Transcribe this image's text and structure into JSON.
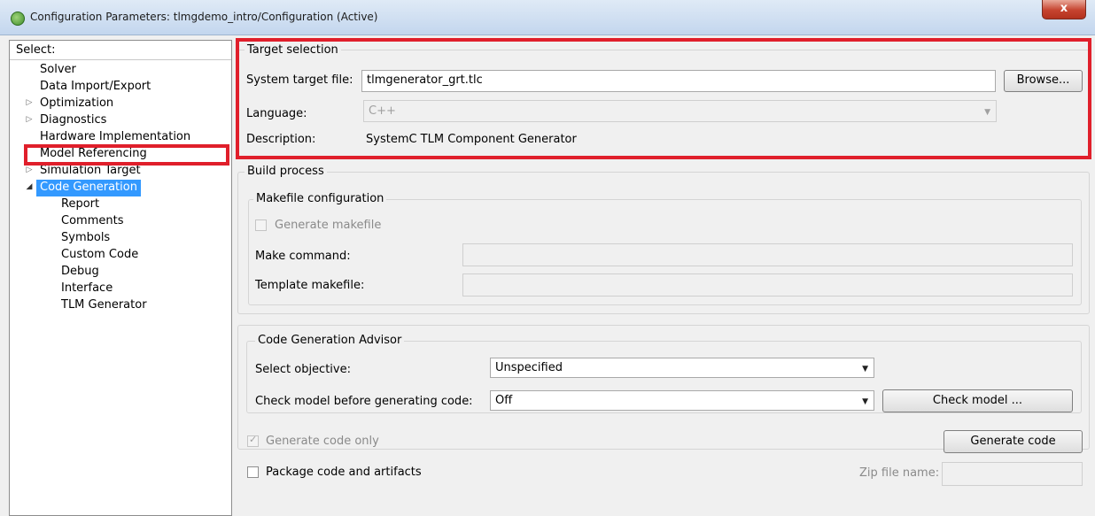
{
  "window": {
    "title": "Configuration Parameters: tlmgdemo_intro/Configuration (Active)",
    "close_glyph": "x",
    "app_icon": "simulink-config-icon"
  },
  "left_pane": {
    "header": "Select:",
    "items": [
      {
        "label": "Solver",
        "expandable": false,
        "level": 0
      },
      {
        "label": "Data Import/Export",
        "expandable": false,
        "level": 0
      },
      {
        "label": "Optimization",
        "expandable": true,
        "expanded": false,
        "level": 0
      },
      {
        "label": "Diagnostics",
        "expandable": true,
        "expanded": false,
        "level": 0
      },
      {
        "label": "Hardware Implementation",
        "expandable": false,
        "level": 0
      },
      {
        "label": "Model Referencing",
        "expandable": false,
        "level": 0
      },
      {
        "label": "Simulation Target",
        "expandable": true,
        "expanded": false,
        "level": 0
      },
      {
        "label": "Code Generation",
        "expandable": true,
        "expanded": true,
        "selected": true,
        "level": 0
      },
      {
        "label": "Report",
        "level": 1
      },
      {
        "label": "Comments",
        "level": 1
      },
      {
        "label": "Symbols",
        "level": 1
      },
      {
        "label": "Custom Code",
        "level": 1
      },
      {
        "label": "Debug",
        "level": 1
      },
      {
        "label": "Interface",
        "level": 1
      },
      {
        "label": "TLM Generator",
        "level": 1
      }
    ],
    "collapsed_glyph": "▷",
    "expanded_glyph": "◢"
  },
  "target_selection": {
    "title": "Target selection",
    "system_target_label": "System target file:",
    "system_target_value": "tlmgenerator_grt.tlc",
    "browse_label": "Browse...",
    "language_label": "Language:",
    "language_value": "C++",
    "description_label": "Description:",
    "description_value": "SystemC TLM Component Generator"
  },
  "build_process": {
    "title": "Build process",
    "makefile_group_title": "Makefile configuration",
    "generate_makefile_label": "Generate makefile",
    "make_command_label": "Make command:",
    "make_command_value": "",
    "template_makefile_label": "Template makefile:",
    "template_makefile_value": ""
  },
  "advisor": {
    "title": "Code Generation Advisor",
    "objective_label": "Select objective:",
    "objective_value": "Unspecified",
    "check_label": "Check model before generating code:",
    "check_value": "Off",
    "check_button": "Check model ..."
  },
  "bottom": {
    "generate_code_only_label": "Generate code only",
    "generate_code_only_checked": true,
    "generate_code_button": "Generate code",
    "package_label": "Package code and artifacts",
    "package_checked": false,
    "zip_label": "Zip file name:",
    "zip_value": ""
  },
  "colors": {
    "highlight": "#e01f2b",
    "selection": "#3399ff",
    "panel": "#f0f0f0"
  }
}
